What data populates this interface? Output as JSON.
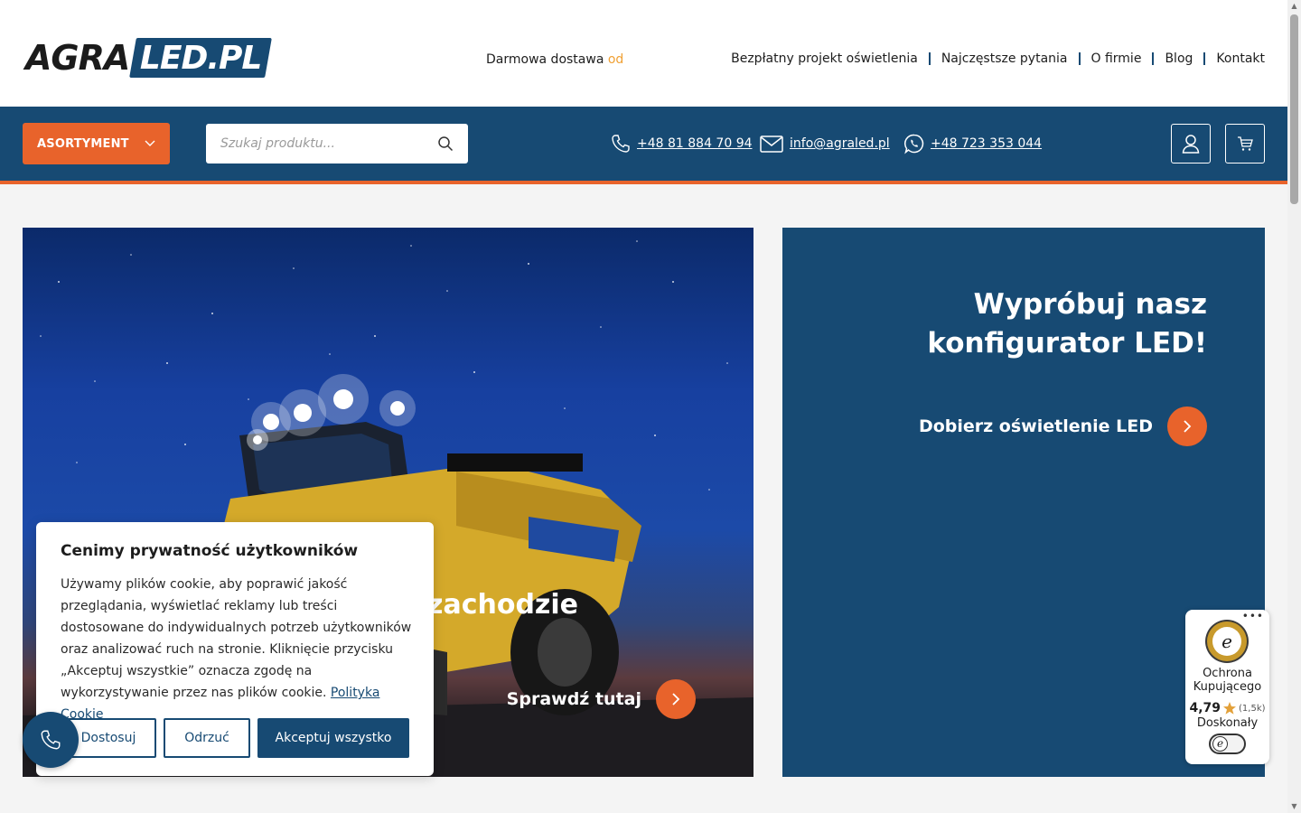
{
  "header": {
    "logo": {
      "part1": "AGRA",
      "part2": "LED.PL"
    },
    "free_shipping": {
      "text": "Darmowa dostawa",
      "accent": "od €"
    },
    "nav": [
      {
        "label": "Bezpłatny projekt oświetlenia"
      },
      {
        "label": "Najczęstsze pytania"
      },
      {
        "label": "O firmie"
      },
      {
        "label": "Blog"
      },
      {
        "label": "Kontakt"
      }
    ]
  },
  "toolbar": {
    "assortment_label": "ASORTYMENT",
    "search": {
      "placeholder": "Szukaj produktu..."
    },
    "phone": "+48 81 884 70 94",
    "email": "info@agraled.pl",
    "whatsapp": "+48 723 353 044",
    "icons": [
      "chevron-down-icon",
      "search-icon",
      "phone-icon",
      "mail-icon",
      "whatsapp-icon",
      "user-icon",
      "cart-icon"
    ]
  },
  "hero": {
    "title_visible": "zachodzie",
    "cta_label": "Sprawdź tutaj"
  },
  "configurator": {
    "title": "Wypróbuj nasz konfigurator LED!",
    "cta_label": "Dobierz oświetlenie LED"
  },
  "cookie": {
    "title": "Cenimy prywatność użytkowników",
    "text": "Używamy plików cookie, aby poprawić jakość przeglądania, wyświetlać reklamy lub treści dostosowane do indywidualnych potrzeb użytkowników oraz analizować ruch na stronie. Kliknięcie przycisku „Akceptuj wszystkie” oznacza zgodę na wykorzystywanie przez nas plików cookie.",
    "policy_link": "Polityka Cookie",
    "buttons": {
      "customize": "Dostosuj",
      "reject": "Odrzuć",
      "accept": "Akceptuj wszystko"
    }
  },
  "trusted_shops": {
    "label": "Ochrona Kupującego",
    "score": "4,79",
    "count": "(1,5k)",
    "grade": "Doskonały"
  },
  "colors": {
    "brand_blue": "#174a73",
    "accent_orange": "#e8632b",
    "shipping_accent": "#f0a033"
  }
}
